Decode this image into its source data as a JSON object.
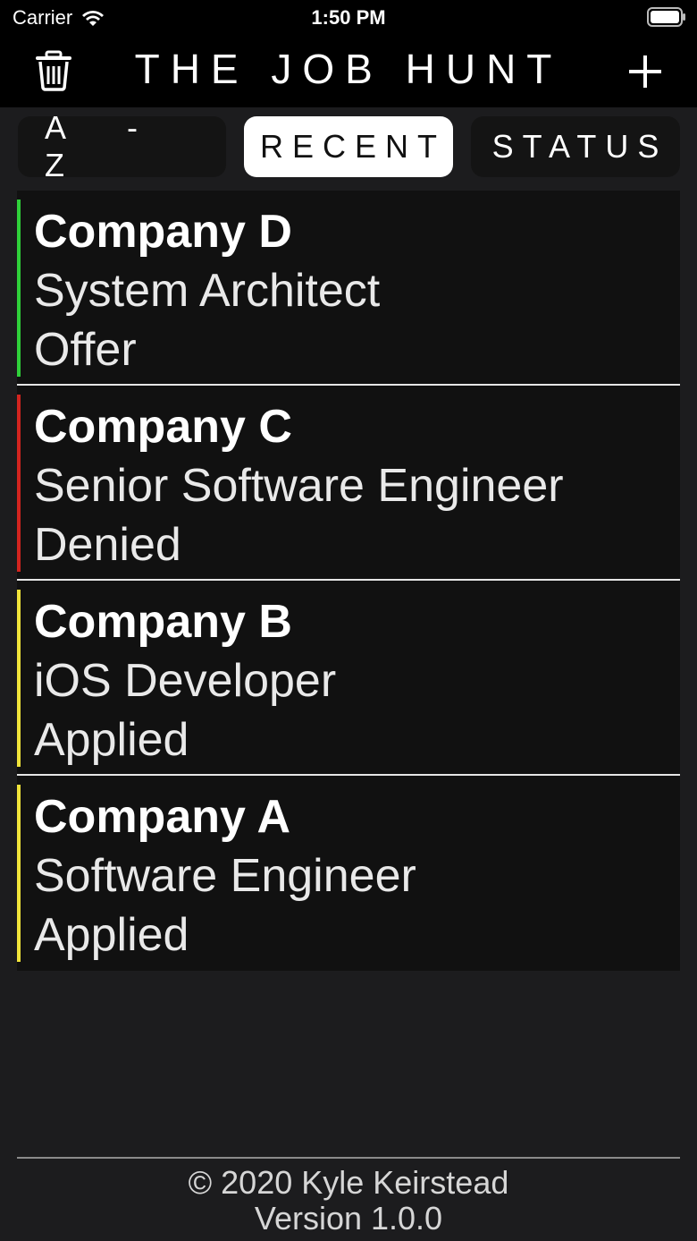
{
  "status_bar": {
    "carrier": "Carrier",
    "time": "1:50 PM"
  },
  "header": {
    "title": "THE JOB HUNT",
    "trash_icon": "trash-icon",
    "add_icon": "plus-icon"
  },
  "sort_tabs": [
    {
      "label": "A - Z",
      "active": false
    },
    {
      "label": "RECENT",
      "active": true
    },
    {
      "label": "STATUS",
      "active": false
    }
  ],
  "jobs": [
    {
      "company": "Company D",
      "role": "System Architect",
      "status": "Offer",
      "color": "#2fd03a"
    },
    {
      "company": "Company C",
      "role": "Senior Software Engineer",
      "status": "Denied",
      "color": "#d2241f"
    },
    {
      "company": "Company B",
      "role": "iOS Developer",
      "status": "Applied",
      "color": "#f0e33a"
    },
    {
      "company": "Company A",
      "role": "Software Engineer",
      "status": "Applied",
      "color": "#f0e33a"
    }
  ],
  "footer": {
    "copyright": "© 2020 Kyle Keirstead",
    "version": "Version 1.0.0"
  }
}
